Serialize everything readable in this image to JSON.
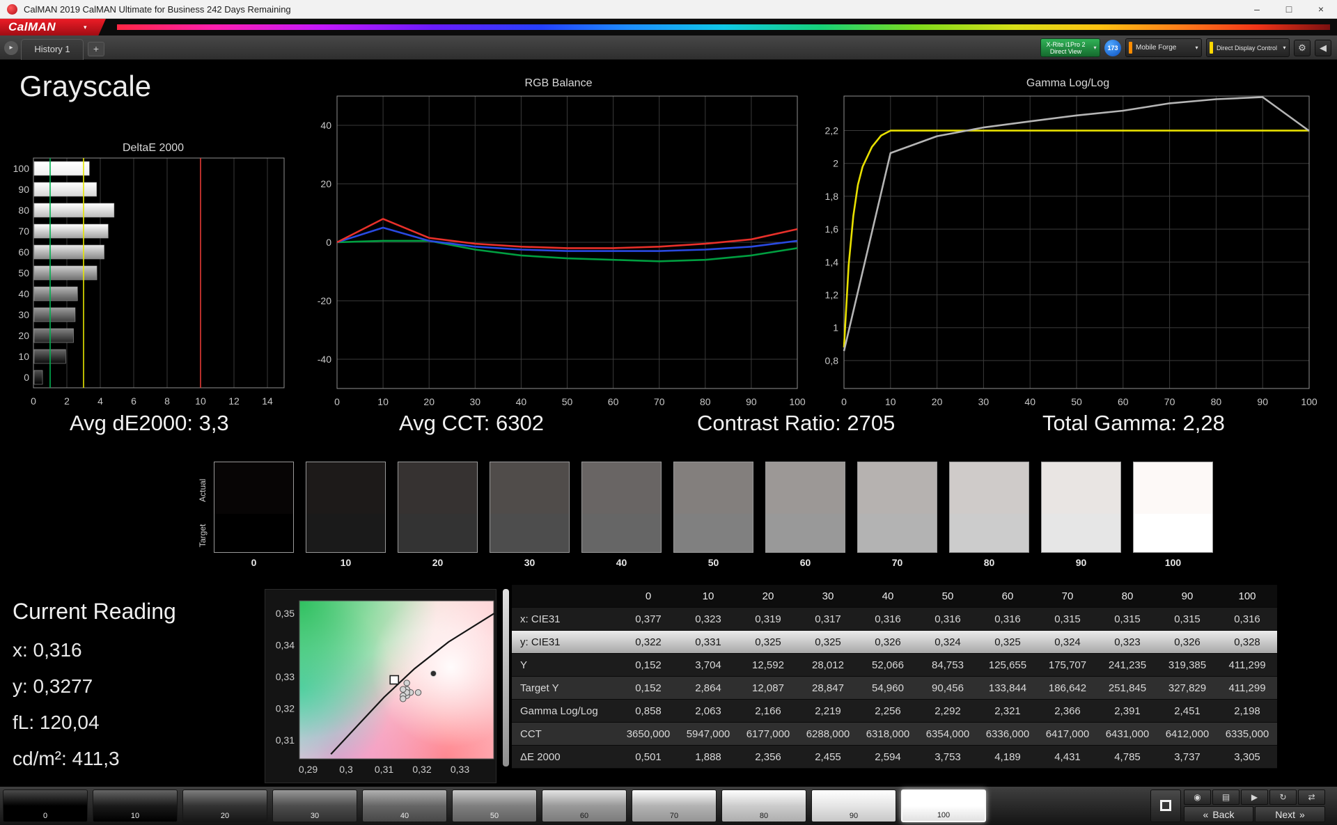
{
  "window": {
    "title": "CalMAN 2019 CalMAN Ultimate for Business 242 Days Remaining",
    "minimize": "–",
    "maximize": "□",
    "close": "×"
  },
  "brand": {
    "logo_text": "CalMAN",
    "dropdown_arrow": "▾"
  },
  "tab_bar": {
    "nav_arrow": "▸",
    "tabs": [
      {
        "label": "History 1"
      }
    ],
    "add_tab": "+",
    "meter_button": {
      "line1": "X-Rite i1Pro 2",
      "line2": "Direct View"
    },
    "meter_badge": "173",
    "source_button": "Mobile Forge",
    "display_button": "Direct Display Control",
    "gear_icon": "⚙",
    "collapse_icon": "◀",
    "dropdown_arrow": "▾",
    "accent_source": "#ff8c00",
    "accent_display": "#ffd800"
  },
  "page": {
    "title": "Grayscale"
  },
  "summary": {
    "avg_de": "Avg dE2000: 3,3",
    "avg_cct": "Avg CCT: 6302",
    "contrast": "Contrast Ratio: 2705",
    "total_gamma": "Total Gamma: 2,28"
  },
  "swatch_strip": {
    "row_label_top": "Actual",
    "row_label_bottom": "Target",
    "swatches": [
      {
        "level": "0",
        "actual": "#070505",
        "target": "#000000"
      },
      {
        "level": "10",
        "actual": "#1d1a19",
        "target": "#1a1a1a"
      },
      {
        "level": "20",
        "actual": "#363231",
        "target": "#333333"
      },
      {
        "level": "30",
        "actual": "#504c4a",
        "target": "#4d4d4d"
      },
      {
        "level": "40",
        "actual": "#696564",
        "target": "#666666"
      },
      {
        "level": "50",
        "actual": "#837f7d",
        "target": "#808080"
      },
      {
        "level": "60",
        "actual": "#9c9896",
        "target": "#999999"
      },
      {
        "level": "70",
        "actual": "#b6b2b0",
        "target": "#b3b3b3"
      },
      {
        "level": "80",
        "actual": "#cfcbc9",
        "target": "#cccccc"
      },
      {
        "level": "90",
        "actual": "#e9e5e3",
        "target": "#e6e6e6"
      },
      {
        "level": "100",
        "actual": "#fdf9f7",
        "target": "#ffffff"
      }
    ]
  },
  "current_reading": {
    "title": "Current Reading",
    "lines": [
      "x: 0,316",
      "y: 0,3277",
      "fL: 120,04",
      "cd/m²: 411,3"
    ]
  },
  "table": {
    "columns": [
      "0",
      "10",
      "20",
      "30",
      "40",
      "50",
      "60",
      "70",
      "80",
      "90",
      "100"
    ],
    "rows": [
      {
        "label": "x: CIE31",
        "selected": false,
        "values": [
          "0,377",
          "0,323",
          "0,319",
          "0,317",
          "0,316",
          "0,316",
          "0,316",
          "0,315",
          "0,315",
          "0,315",
          "0,316"
        ]
      },
      {
        "label": "y: CIE31",
        "selected": true,
        "values": [
          "0,322",
          "0,331",
          "0,325",
          "0,325",
          "0,326",
          "0,324",
          "0,325",
          "0,324",
          "0,323",
          "0,326",
          "0,328"
        ]
      },
      {
        "label": "Y",
        "selected": false,
        "values": [
          "0,152",
          "3,704",
          "12,592",
          "28,012",
          "52,066",
          "84,753",
          "125,655",
          "175,707",
          "241,235",
          "319,385",
          "411,299"
        ]
      },
      {
        "label": "Target Y",
        "selected": false,
        "values": [
          "0,152",
          "2,864",
          "12,087",
          "28,847",
          "54,960",
          "90,456",
          "133,844",
          "186,642",
          "251,845",
          "327,829",
          "411,299"
        ]
      },
      {
        "label": "Gamma Log/Log",
        "selected": false,
        "values": [
          "0,858",
          "2,063",
          "2,166",
          "2,219",
          "2,256",
          "2,292",
          "2,321",
          "2,366",
          "2,391",
          "2,451",
          "2,198"
        ]
      },
      {
        "label": "CCT",
        "selected": false,
        "values": [
          "3650,000",
          "5947,000",
          "6177,000",
          "6288,000",
          "6318,000",
          "6354,000",
          "6336,000",
          "6417,000",
          "6431,000",
          "6412,000",
          "6335,000"
        ]
      },
      {
        "label": "ΔE 2000",
        "selected": false,
        "values": [
          "0,501",
          "1,888",
          "2,356",
          "2,455",
          "2,594",
          "3,753",
          "4,189",
          "4,431",
          "4,785",
          "3,737",
          "3,305"
        ]
      }
    ]
  },
  "toolbar": {
    "levels": [
      "0",
      "10",
      "20",
      "30",
      "40",
      "50",
      "60",
      "70",
      "80",
      "90",
      "100"
    ],
    "selected_level": "100",
    "small_buttons": [
      "◉",
      "▤",
      "▶",
      "↻",
      "⇄"
    ],
    "back_chevron": "«",
    "back_label": "Back",
    "next_label": "Next",
    "next_chevron": "»"
  },
  "chart_data": [
    {
      "id": "deltae",
      "type": "bar",
      "orientation": "horizontal",
      "title": "DeltaE 2000",
      "categories": [
        "100",
        "90",
        "80",
        "70",
        "60",
        "50",
        "40",
        "30",
        "20",
        "10",
        "0"
      ],
      "bar_levels": [
        100,
        90,
        80,
        70,
        60,
        50,
        40,
        30,
        20,
        10,
        0
      ],
      "values": [
        3.305,
        3.737,
        4.785,
        4.431,
        4.189,
        3.753,
        2.594,
        2.455,
        2.356,
        1.888,
        0.501
      ],
      "xlim": [
        0,
        15
      ],
      "xtick_values": [
        0,
        2,
        4,
        6,
        8,
        10,
        12,
        14
      ],
      "xtick_labels": [
        "0",
        "2",
        "4",
        "6",
        "8",
        "10",
        "12",
        "14"
      ],
      "grid": true,
      "reference_lines": [
        {
          "name": "good-threshold",
          "value": 1,
          "color": "#00b050"
        },
        {
          "name": "warning-threshold",
          "value": 3,
          "color": "#e6e600"
        },
        {
          "name": "error-threshold",
          "value": 10,
          "color": "#e53935"
        }
      ]
    },
    {
      "id": "rgb_balance",
      "type": "line",
      "title": "RGB Balance",
      "x": [
        0,
        10,
        20,
        30,
        40,
        50,
        60,
        70,
        80,
        90,
        100
      ],
      "xlim": [
        0,
        100
      ],
      "xtick_values": [
        0,
        10,
        20,
        30,
        40,
        50,
        60,
        70,
        80,
        90,
        100
      ],
      "xtick_labels": [
        "0",
        "10",
        "20",
        "30",
        "40",
        "50",
        "60",
        "70",
        "80",
        "90",
        "100"
      ],
      "ylim": [
        -50,
        50
      ],
      "ytick_values": [
        40,
        20,
        0,
        -20,
        -40
      ],
      "ytick_labels": [
        "40",
        "20",
        "0",
        "-20",
        "-40"
      ],
      "grid": true,
      "series": [
        {
          "name": "green",
          "color": "#009e40",
          "values": [
            0,
            0.5,
            0.5,
            -2.5,
            -4.5,
            -5.5,
            -6,
            -6.5,
            -6,
            -4.5,
            -2
          ]
        },
        {
          "name": "blue",
          "color": "#2949e0",
          "values": [
            0,
            5,
            0.5,
            -1.5,
            -2.5,
            -3,
            -3,
            -3,
            -2.5,
            -1.5,
            0.5
          ]
        },
        {
          "name": "red",
          "color": "#e8302a",
          "values": [
            0,
            8,
            1.5,
            -0.5,
            -1.5,
            -2,
            -2,
            -1.5,
            -0.5,
            1,
            4.5
          ]
        }
      ]
    },
    {
      "id": "gamma",
      "type": "line",
      "title": "Gamma Log/Log",
      "x": [
        0,
        10,
        20,
        30,
        40,
        50,
        60,
        70,
        80,
        90,
        100
      ],
      "xlim": [
        0,
        100
      ],
      "xtick_values": [
        0,
        10,
        20,
        30,
        40,
        50,
        60,
        70,
        80,
        90,
        100
      ],
      "xtick_labels": [
        "0",
        "10",
        "20",
        "30",
        "40",
        "50",
        "60",
        "70",
        "80",
        "90",
        "100"
      ],
      "ylim": [
        0.63,
        2.41
      ],
      "ytick_values": [
        2.2,
        2,
        1.8,
        1.6,
        1.4,
        1.2,
        1,
        0.8
      ],
      "ytick_labels": [
        "2,2",
        "2",
        "1,8",
        "1,6",
        "1,4",
        "1,2",
        "1",
        "0,8"
      ],
      "grid": true,
      "series": [
        {
          "name": "target",
          "color": "#e8e000",
          "x": [
            0,
            1,
            2,
            3,
            4,
            6,
            8,
            10,
            100
          ],
          "values": [
            0.88,
            1.38,
            1.68,
            1.87,
            1.98,
            2.1,
            2.17,
            2.2,
            2.2
          ]
        },
        {
          "name": "measured",
          "color": "#b5b5b5",
          "x": [
            0,
            10,
            20,
            30,
            40,
            50,
            60,
            70,
            80,
            90,
            100
          ],
          "values": [
            0.858,
            2.063,
            2.166,
            2.219,
            2.256,
            2.292,
            2.321,
            2.366,
            2.391,
            2.451,
            2.198
          ]
        }
      ]
    },
    {
      "id": "cie",
      "type": "scatter",
      "title": "",
      "xlim": [
        0.2877,
        0.3389
      ],
      "ylim": [
        0.304,
        0.354
      ],
      "xtick_values": [
        0.29,
        0.3,
        0.31,
        0.32,
        0.33
      ],
      "xtick_labels": [
        "0,29",
        "0,3",
        "0,31",
        "0,32",
        "0,33"
      ],
      "ytick_values": [
        0.35,
        0.34,
        0.33,
        0.32,
        0.31
      ],
      "ytick_labels": [
        "0,35",
        "0,34",
        "0,33",
        "0,32",
        "0,31"
      ],
      "locus": [
        [
          0.296,
          0.3055
        ],
        [
          0.303,
          0.3145
        ],
        [
          0.31,
          0.3235
        ],
        [
          0.318,
          0.3325
        ],
        [
          0.327,
          0.341
        ],
        [
          0.339,
          0.35
        ]
      ],
      "target_point": {
        "x": 0.3127,
        "y": 0.329
      },
      "points": [
        {
          "x": 0.323,
          "y": 0.331
        },
        {
          "x": 0.319,
          "y": 0.325
        },
        {
          "x": 0.317,
          "y": 0.325
        },
        {
          "x": 0.316,
          "y": 0.326
        },
        {
          "x": 0.316,
          "y": 0.324
        },
        {
          "x": 0.316,
          "y": 0.325
        },
        {
          "x": 0.315,
          "y": 0.324
        },
        {
          "x": 0.315,
          "y": 0.323
        },
        {
          "x": 0.315,
          "y": 0.326
        },
        {
          "x": 0.316,
          "y": 0.328
        }
      ]
    }
  ]
}
